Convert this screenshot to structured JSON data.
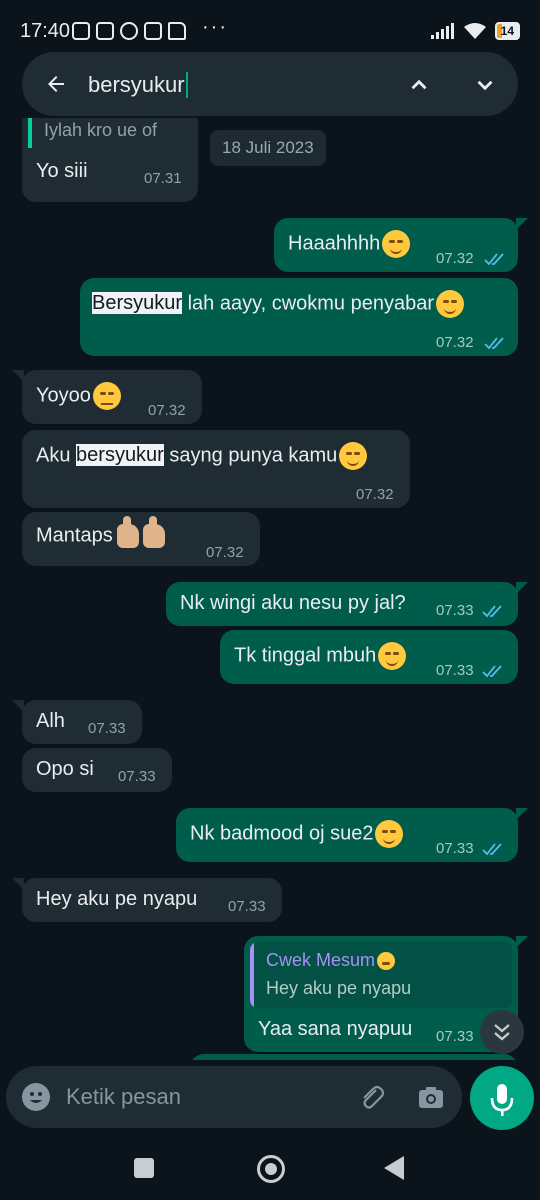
{
  "status_bar": {
    "time": "17:40",
    "battery": "14",
    "icons_left": [
      "mute-icon",
      "nfc-icon",
      "whatsapp-icon",
      "app-icon",
      "file-icon"
    ],
    "more": "···"
  },
  "search": {
    "query": "bersyukur"
  },
  "date_chip": "18 Juli 2023",
  "messages": [
    {
      "id": 0,
      "dir": "in",
      "quote": "Iylah kro ue of",
      "text": "Yo siii",
      "time": "07.31"
    },
    {
      "id": 1,
      "dir": "out",
      "text": "Haaahhhh",
      "time": "07.32",
      "emoji": "relieved"
    },
    {
      "id": 2,
      "dir": "out",
      "highlight": "Bersyukur",
      "text": " lah aayy, cwokmu penyabar",
      "time": "07.32",
      "emoji": "smile"
    },
    {
      "id": 3,
      "dir": "in",
      "text": "Yoyoo",
      "time": "07.32",
      "emoji": "expressionless"
    },
    {
      "id": 4,
      "dir": "in",
      "prefix": "Aku ",
      "highlight": "bersyukur",
      "text": " sayng punya kamu",
      "time": "07.32",
      "emoji": "smile"
    },
    {
      "id": 5,
      "dir": "in",
      "text": "Mantaps",
      "time": "07.32",
      "emoji": "thumbs-up"
    },
    {
      "id": 6,
      "dir": "out",
      "text": "Nk wingi aku nesu py jal?",
      "time": "07.33"
    },
    {
      "id": 7,
      "dir": "out",
      "text": "Tk tinggal mbuh",
      "time": "07.33",
      "emoji": "smile"
    },
    {
      "id": 8,
      "dir": "in",
      "text": "Alh",
      "time": "07.33"
    },
    {
      "id": 9,
      "dir": "in",
      "text": "Opo si",
      "time": "07.33"
    },
    {
      "id": 10,
      "dir": "out",
      "text": "Nk badmood oj sue2",
      "time": "07.33",
      "emoji": "smile"
    },
    {
      "id": 11,
      "dir": "in",
      "text": "Hey aku pe nyapu",
      "time": "07.33"
    },
    {
      "id": 12,
      "dir": "out",
      "reply_name": "Cwek Mesum",
      "reply_text": "Hey aku pe nyapu",
      "text": "Yaa sana nyapuu",
      "time": "07.33"
    }
  ],
  "input": {
    "placeholder": "Ketik pesan"
  },
  "colors": {
    "bg": "#0b141a",
    "incoming": "#202c33",
    "outgoing": "#005c4b",
    "accent": "#00a884",
    "ticks": "#53bdeb"
  }
}
